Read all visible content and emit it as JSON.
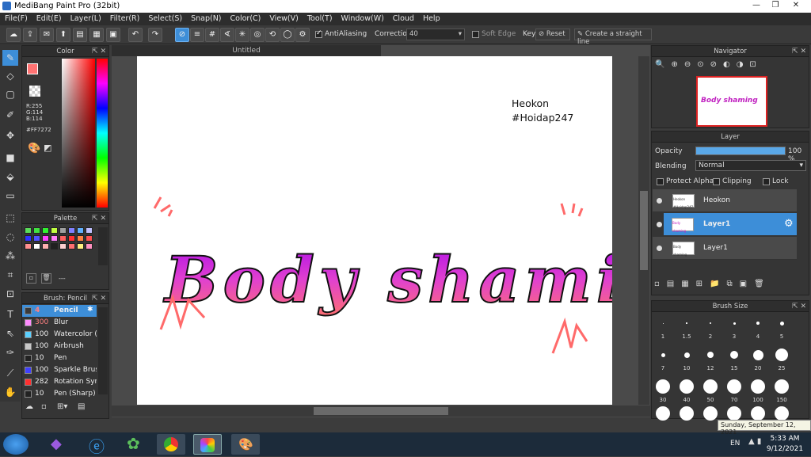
{
  "window": {
    "title": "MediBang Paint Pro (32bit)"
  },
  "menu": [
    "File(F)",
    "Edit(E)",
    "Layer(L)",
    "Filter(R)",
    "Select(S)",
    "Snap(N)",
    "Color(C)",
    "View(V)",
    "Tool(T)",
    "Window(W)",
    "Cloud",
    "Help"
  ],
  "toolbar": {
    "antialias_label": "AntiAliasing",
    "correction_label": "Correction",
    "correction_value": "40",
    "soft_edge_label": "Soft Edge",
    "key_label": "Key",
    "reset_label": "Reset",
    "straight_line_label": "Create a straight line"
  },
  "color_panel": {
    "title": "Color",
    "r": "R:255",
    "g": "G:114",
    "b": "B:114",
    "hex": "#FF7272",
    "fg_color": "#FF7272",
    "bg_color": "#ffffff"
  },
  "palette_panel": {
    "title": "Palette",
    "more": "---"
  },
  "brush_panel": {
    "title": "Brush: Pencil",
    "items": [
      {
        "size": "4",
        "name": "Pencil",
        "color": "#3a3a3a"
      },
      {
        "size": "300",
        "name": "Blur",
        "color": "#ff8cff"
      },
      {
        "size": "100",
        "name": "Watercolor (W",
        "color": "#5ad0ff"
      },
      {
        "size": "100",
        "name": "Airbrush",
        "color": "#c8c8c8"
      },
      {
        "size": "10",
        "name": "Pen",
        "color": "#222222"
      },
      {
        "size": "100",
        "name": "Sparkle Brush",
        "color": "#4040ff"
      },
      {
        "size": "282",
        "name": "Rotation Sym",
        "color": "#ff3030"
      },
      {
        "size": "10",
        "name": "Pen (Sharp)",
        "color": "#222222"
      }
    ]
  },
  "document": {
    "tab": "Untitled",
    "text_line1": "Heokon",
    "text_line2": "#Hoidap247",
    "art_text": "Body shaming"
  },
  "navigator": {
    "title": "Navigator",
    "thumb_text": "Body shaming"
  },
  "layer_panel": {
    "title": "Layer",
    "opacity_label": "Opacity",
    "opacity_value": "100 %",
    "opacity_fraction": 1.0,
    "blending_label": "Blending",
    "blending_value": "Normal",
    "protect_alpha_label": "Protect Alpha",
    "clipping_label": "Clipping",
    "lock_label": "Lock",
    "layers": [
      {
        "name": "Heokon",
        "selected": false,
        "thumb_text": "Heokon #Hoidap247"
      },
      {
        "name": "Layer1",
        "selected": true,
        "thumb_text": "Body shaming"
      },
      {
        "name": "Layer1",
        "selected": false,
        "thumb_text": "Body shaming"
      }
    ]
  },
  "brush_size_panel": {
    "title": "Brush Size",
    "sizes": [
      "1",
      "1.5",
      "2",
      "3",
      "4",
      "5",
      "7",
      "10",
      "12",
      "15",
      "20",
      "25",
      "30",
      "40",
      "50",
      "70",
      "100",
      "150"
    ]
  },
  "taskbar": {
    "tooltip": "Sunday, September 12, 2021",
    "lang": "EN",
    "time": "5:33 AM",
    "date": "9/12/2021"
  }
}
